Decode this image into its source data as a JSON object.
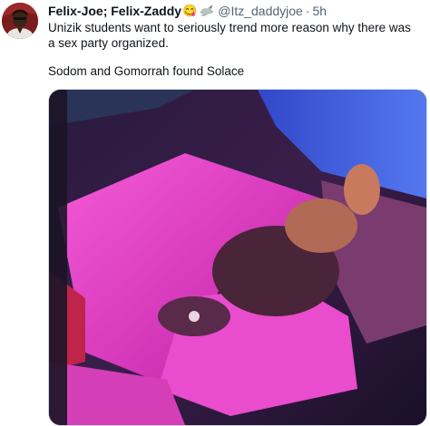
{
  "tweet": {
    "author": {
      "display_name": "Felix-Joe; Felix-Zaddy",
      "emoji": "😋",
      "handle": "@Itz_daddyjoe",
      "separator": "·",
      "time": "5h"
    },
    "text_line1": "Unizik students want to seriously trend more reason why there was a sex party organized.",
    "text_line2": "Sodom and Gomorrah found Solace"
  },
  "icons": {
    "badge": "dove-icon"
  },
  "colors": {
    "text": "#0f1419",
    "secondary": "#536471",
    "media_pink": "#e040c8",
    "media_blue": "#3a5bd8"
  }
}
